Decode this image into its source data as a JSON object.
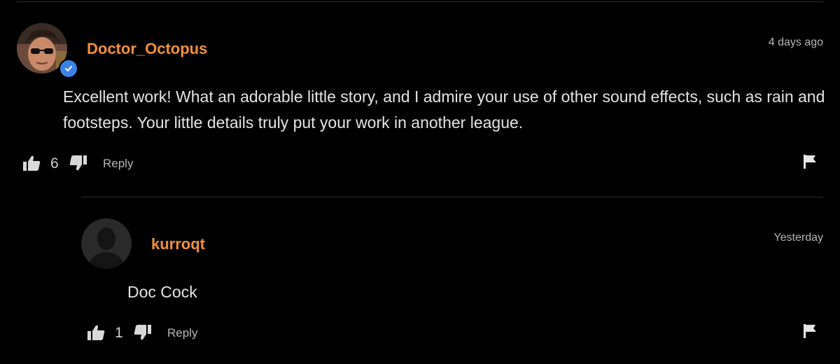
{
  "comments": [
    {
      "username": "Doctor_Octopus",
      "verified": true,
      "timestamp": "4 days ago",
      "text": "Excellent work! What an adorable little story, and I admire your use of other sound effects, such as rain and footsteps. Your little details truly put your work in another league.",
      "likes": "6",
      "reply_label": "Reply"
    },
    {
      "username": "kurroqt",
      "verified": false,
      "timestamp": "Yesterday",
      "text": "Doc Cock",
      "likes": "1",
      "reply_label": "Reply"
    }
  ],
  "colors": {
    "background": "#000000",
    "username": "#f0913a",
    "verified_badge": "#3b82e6",
    "text": "#e4e4e4",
    "muted": "#b7b7b7"
  },
  "icons": {
    "like": "thumbs-up-icon",
    "dislike": "thumbs-down-icon",
    "flag": "flag-icon",
    "verified": "check-badge-icon"
  }
}
